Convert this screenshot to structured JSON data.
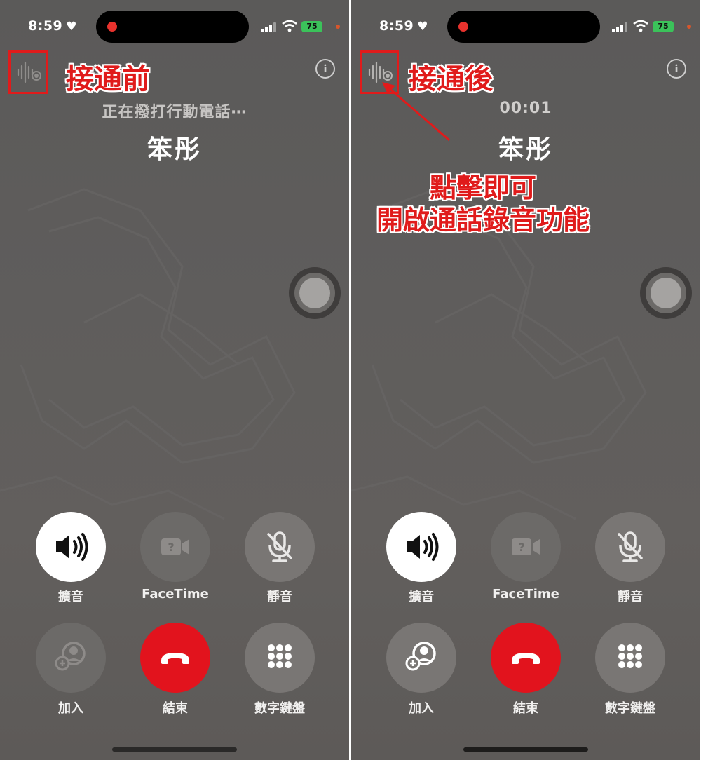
{
  "left": {
    "status_time": "8:59",
    "annotation_title": "接通前",
    "call_status": "正在撥打行動電話⋯",
    "contact_name": "笨彤",
    "controls": {
      "speaker": "擴音",
      "facetime": "FaceTime",
      "mute": "靜音",
      "add": "加入",
      "end": "結束",
      "keypad": "數字鍵盤"
    },
    "battery": "75"
  },
  "right": {
    "status_time": "8:59",
    "annotation_title": "接通後",
    "call_timer": "00:01",
    "contact_name": "笨彤",
    "annotation_tip_line1": "點擊即可",
    "annotation_tip_line2": "開啟通話錄音功能",
    "controls": {
      "speaker": "擴音",
      "facetime": "FaceTime",
      "mute": "靜音",
      "add": "加入",
      "end": "結束",
      "keypad": "數字鍵盤"
    },
    "battery": "75"
  },
  "colors": {
    "annotation_red": "#e01b1b",
    "end_call_red": "#e2131d",
    "battery_green": "#3bc25a"
  }
}
